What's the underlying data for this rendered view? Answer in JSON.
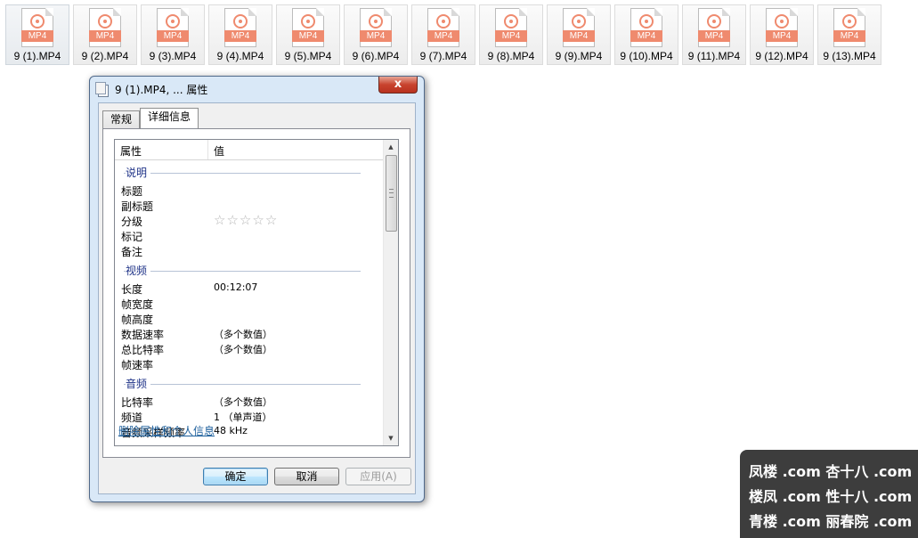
{
  "files": [
    {
      "name": "9 (1).MP4",
      "badge": "MP4",
      "selected": true
    },
    {
      "name": "9 (2).MP4",
      "badge": "MP4"
    },
    {
      "name": "9 (3).MP4",
      "badge": "MP4"
    },
    {
      "name": "9 (4).MP4",
      "badge": "MP4"
    },
    {
      "name": "9 (5).MP4",
      "badge": "MP4"
    },
    {
      "name": "9 (6).MP4",
      "badge": "MP4"
    },
    {
      "name": "9 (7).MP4",
      "badge": "MP4"
    },
    {
      "name": "9 (8).MP4",
      "badge": "MP4"
    },
    {
      "name": "9 (9).MP4",
      "badge": "MP4"
    },
    {
      "name": "9 (10).MP4",
      "badge": "MP4"
    },
    {
      "name": "9 (11).MP4",
      "badge": "MP4"
    },
    {
      "name": "9 (12).MP4",
      "badge": "MP4"
    },
    {
      "name": "9 (13).MP4",
      "badge": "MP4"
    }
  ],
  "file_icon": "video-file-icon",
  "accent_color": "#ef8a6e",
  "dialog": {
    "title": "9 (1).MP4, ... 属性",
    "close_label": "x",
    "tabs": [
      "常规",
      "详细信息"
    ],
    "active_tab": "详细信息",
    "columns": {
      "property": "属性",
      "value": "值"
    },
    "groups": [
      {
        "title": "说明",
        "rows": [
          {
            "k": "标题",
            "v": ""
          },
          {
            "k": "副标题",
            "v": ""
          },
          {
            "k": "分级",
            "v": "",
            "stars": 5,
            "rating": 0
          },
          {
            "k": "标记",
            "v": ""
          },
          {
            "k": "备注",
            "v": ""
          }
        ]
      },
      {
        "title": "视频",
        "rows": [
          {
            "k": "长度",
            "v": "00:12:07"
          },
          {
            "k": "帧宽度",
            "v": ""
          },
          {
            "k": "帧高度",
            "v": ""
          },
          {
            "k": "数据速率",
            "v": "（多个数值）"
          },
          {
            "k": "总比特率",
            "v": "（多个数值）"
          },
          {
            "k": "帧速率",
            "v": ""
          }
        ]
      },
      {
        "title": "音频",
        "rows": [
          {
            "k": "比特率",
            "v": "（多个数值）"
          },
          {
            "k": "频道",
            "v": "1 （单声道）"
          },
          {
            "k": "音频采样频率",
            "v": "48 kHz"
          }
        ]
      }
    ],
    "remove_link": "删除属性和个人信息",
    "buttons": {
      "ok": "确定",
      "cancel": "取消",
      "apply": "应用(A)"
    }
  },
  "watermark": {
    "lines": [
      "凤楼 .com  杏十八 .com",
      "楼凤 .com  性十八 .com",
      "青楼 .com  丽春院 .com"
    ]
  }
}
